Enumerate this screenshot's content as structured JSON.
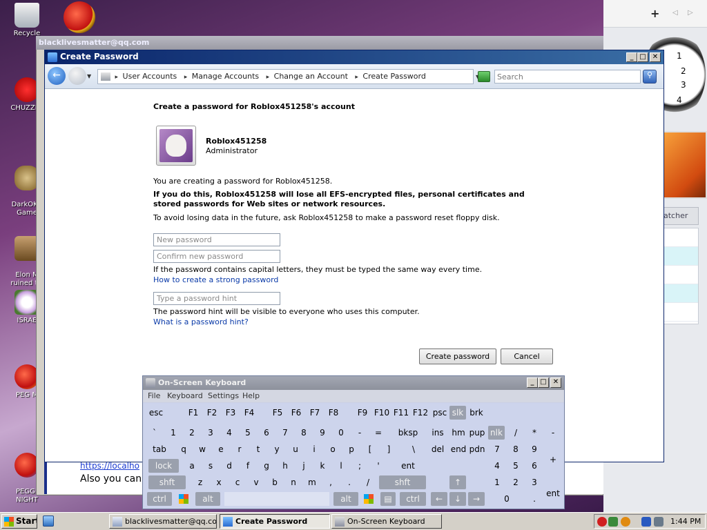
{
  "desktop": {
    "icons": [
      {
        "label": "Recycle"
      },
      {
        "label": "CHUZZLE"
      },
      {
        "label": "DarkOK W\nGame"
      },
      {
        "label": "Elon Mu\nruined tw"
      },
      {
        "label": "ISRAE"
      },
      {
        "label": "PEG M"
      },
      {
        "label": "PEGGIN\nNIGHT"
      }
    ],
    "colors": {
      "desktop_dark": "#3b1f4a",
      "desktop_light": "#c7a8cf"
    }
  },
  "sidebar": {
    "add_label": "+",
    "prev_label": "◁",
    "next_label": "▷",
    "clock_numbers": [
      "1",
      "2",
      "3",
      "4"
    ],
    "gadget_title": "atcher"
  },
  "background_window": {
    "title": "blacklivesmatter@qq.com",
    "link_fragment": "https://localho",
    "text_fragment": "Also you can"
  },
  "window": {
    "title": "Create Password",
    "controls": {
      "minimize": "_",
      "maximize": "□",
      "close": "✕"
    },
    "breadcrumbs": [
      "User Accounts",
      "Manage Accounts",
      "Change an Account",
      "Create Password"
    ],
    "search": {
      "placeholder": "Search"
    },
    "heading": "Create a password for Roblox451258's account",
    "account": {
      "name": "Roblox451258",
      "role": "Administrator"
    },
    "info": "You are creating a password for Roblox451258.",
    "warning": "If you do this, Roblox451258 will lose all EFS-encrypted files, personal certificates and stored passwords for Web sites or network resources.",
    "advice": "To avoid losing data in the future, ask Roblox451258 to make a password reset floppy disk.",
    "new_password": {
      "placeholder": "New password"
    },
    "confirm_password": {
      "placeholder": "Confirm new password"
    },
    "caps_note": "If the password contains capital letters, they must be typed the same way every time.",
    "strong_link": "How to create a strong password",
    "hint": {
      "placeholder": "Type a password hint"
    },
    "hint_note": "The password hint will be visible to everyone who uses this computer.",
    "hint_link": "What is a password hint?",
    "buttons": {
      "create": "Create password",
      "cancel": "Cancel"
    }
  },
  "osk": {
    "title": "On-Screen Keyboard",
    "menu": [
      "File",
      "Keyboard",
      "Settings",
      "Help"
    ],
    "keys": {
      "esc": "esc",
      "f": [
        "F1",
        "F2",
        "F3",
        "F4",
        "F5",
        "F6",
        "F7",
        "F8",
        "F9",
        "F10",
        "F11",
        "F12"
      ],
      "psc": "psc",
      "slk": "slk",
      "brk": "brk",
      "row1": [
        "`",
        "1",
        "2",
        "3",
        "4",
        "5",
        "6",
        "7",
        "8",
        "9",
        "0",
        "-",
        "="
      ],
      "bksp": "bksp",
      "ins": "ins",
      "hm": "hm",
      "pup": "pup",
      "nlk": "nlk",
      "divide": "/",
      "multiply": "*",
      "minus": "-",
      "tab": "tab",
      "row2": [
        "q",
        "w",
        "e",
        "r",
        "t",
        "y",
        "u",
        "i",
        "o",
        "p",
        "[",
        "]",
        "\\"
      ],
      "del": "del",
      "end": "end",
      "pdn": "pdn",
      "n7": "7",
      "n8": "8",
      "n9": "9",
      "plus": "+",
      "lock": "lock",
      "row3": [
        "a",
        "s",
        "d",
        "f",
        "g",
        "h",
        "j",
        "k",
        "l",
        ";",
        "'"
      ],
      "ent": "ent",
      "n4": "4",
      "n5": "5",
      "n6": "6",
      "shft": "shft",
      "row4": [
        "z",
        "x",
        "c",
        "v",
        "b",
        "n",
        "m",
        ",",
        ".",
        "/"
      ],
      "up": "↑",
      "n1": "1",
      "n2": "2",
      "n3": "3",
      "ctrl": "ctrl",
      "alt": "alt",
      "left": "←",
      "down": "↓",
      "right": "→",
      "n0": "0",
      "dot": ".",
      "nent": "ent"
    }
  },
  "taskbar": {
    "start": "Start",
    "tasks": [
      "blacklivesmatter@qq.com",
      "Create Password",
      "On-Screen Keyboard"
    ],
    "time": "1:44 PM"
  }
}
